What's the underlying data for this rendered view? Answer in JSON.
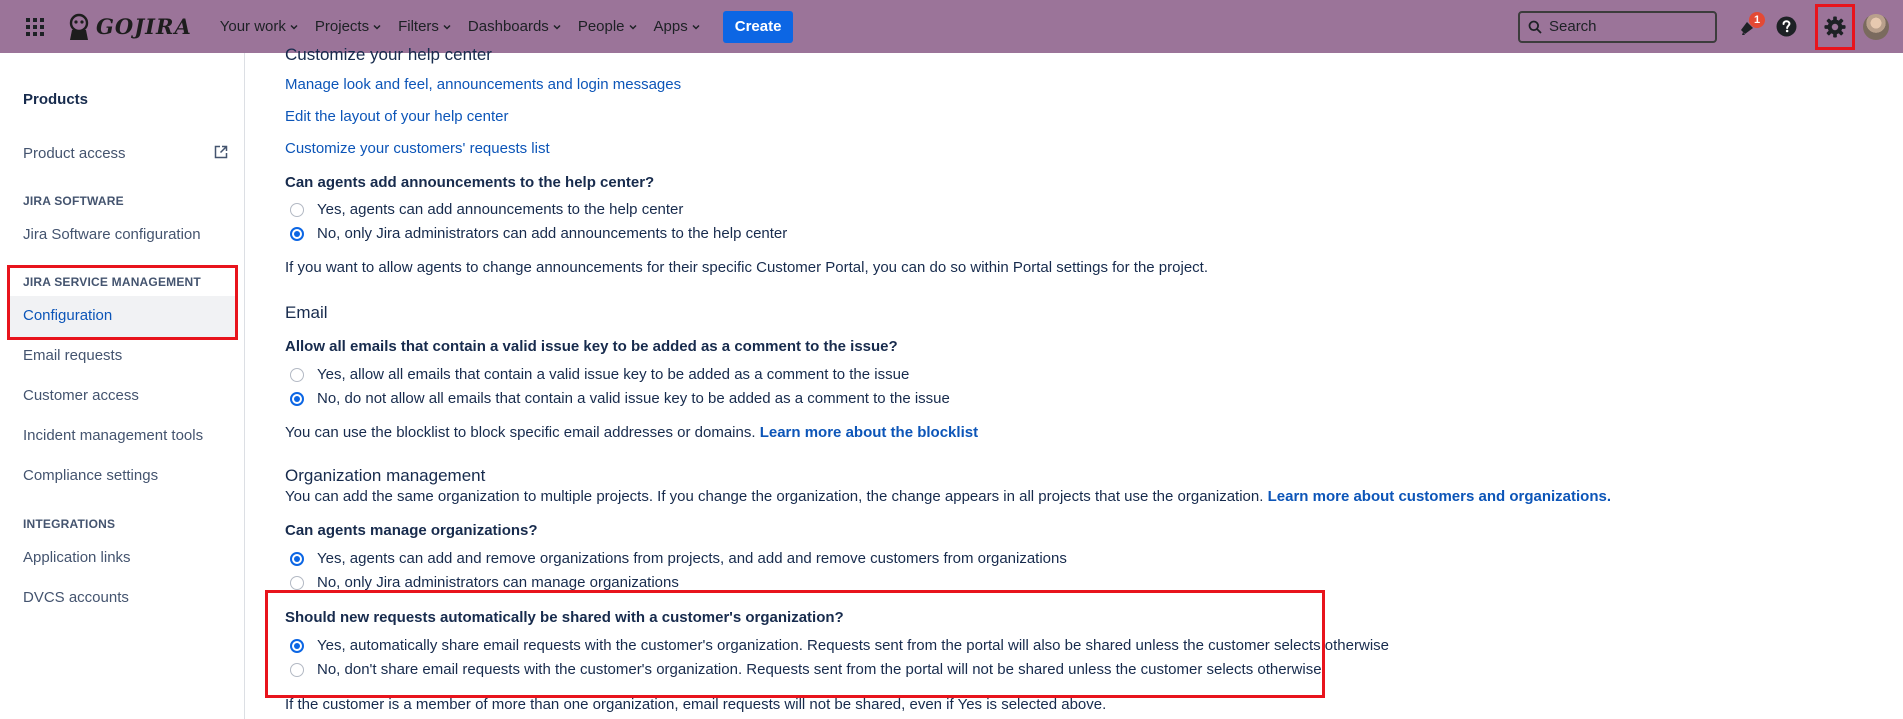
{
  "topnav": {
    "logo_text": "GOJIRA",
    "items": [
      {
        "label": "Your work"
      },
      {
        "label": "Projects"
      },
      {
        "label": "Filters"
      },
      {
        "label": "Dashboards"
      },
      {
        "label": "People"
      },
      {
        "label": "Apps"
      }
    ],
    "create_label": "Create",
    "search_placeholder": "Search",
    "notification_count": "1",
    "colors": {
      "bar": "#9b7499",
      "create": "#0c66e4",
      "highlight": "#e8141c"
    }
  },
  "sidebar": {
    "heading": "Products",
    "product_access": "Product access",
    "section_software": "JIRA SOFTWARE",
    "software_config": "Jira Software configuration",
    "section_jsm": "JIRA SERVICE MANAGEMENT",
    "configuration": "Configuration",
    "email_requests": "Email requests",
    "customer_access": "Customer access",
    "incident_tools": "Incident management tools",
    "compliance": "Compliance settings",
    "section_integrations": "INTEGRATIONS",
    "app_links": "Application links",
    "dvcs": "DVCS accounts"
  },
  "main": {
    "help_center_heading": "Customize your help center",
    "link_look_feel": "Manage look and feel, announcements and login messages",
    "link_edit_layout": "Edit the layout of your help center",
    "link_customize_requests": "Customize your customers' requests list",
    "q_announcements": "Can agents add announcements to the help center?",
    "opt_ann_yes": "Yes, agents can add announcements to the help center",
    "opt_ann_no": "No, only Jira administrators can add announcements to the help center",
    "ann_note": "If you want to allow agents to change announcements for their specific Customer Portal, you can do so within Portal settings for the project.",
    "email_title": "Email",
    "q_email": "Allow all emails that contain a valid issue key to be added as a comment to the issue?",
    "opt_email_yes": "Yes, allow all emails that contain a valid issue key to be added as a comment to the issue",
    "opt_email_no": "No, do not allow all emails that contain a valid issue key to be added as a comment to the issue",
    "blocklist_text": "You can use the blocklist to block specific email addresses or domains.",
    "blocklist_link": "Learn more about the blocklist",
    "org_title": "Organization management",
    "org_desc": "You can add the same organization to multiple projects. If you change the organization, the change appears in all projects that use the organization.",
    "org_link": "Learn more about customers and organizations.",
    "q_manage_orgs": "Can agents manage organizations?",
    "opt_org_yes": "Yes, agents can add and remove organizations from projects, and add and remove customers from organizations",
    "opt_org_no": "No, only Jira administrators can manage organizations",
    "q_share": "Should new requests automatically be shared with a customer's organization?",
    "opt_share_yes": "Yes, automatically share email requests with the customer's organization. Requests sent from the portal will also be shared unless the customer selects otherwise",
    "opt_share_no": "No, don't share email requests with the customer's organization. Requests sent from the portal will not be shared unless the customer selects otherwise",
    "share_note": "If the customer is a member of more than one organization, email requests will not be shared, even if Yes is selected above."
  }
}
